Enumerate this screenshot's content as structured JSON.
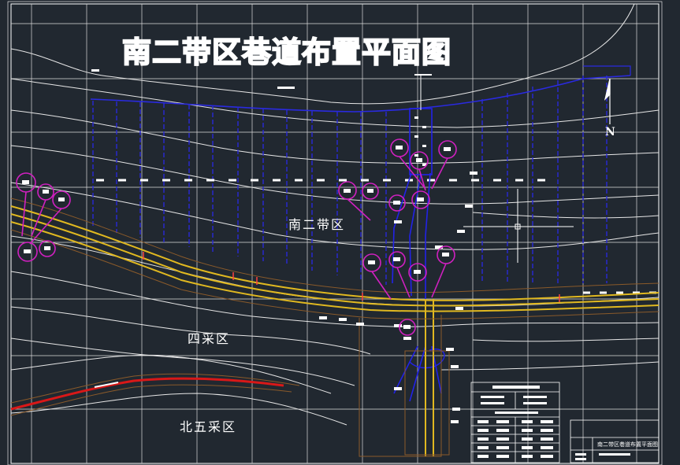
{
  "drawing": {
    "title": "南二带区巷道布置平面图",
    "north_label": "N",
    "zones": {
      "nan_er": "南二带区",
      "si_cai": "四采区",
      "bei_wu": "北五采区"
    },
    "title_block": {
      "drawing_name": "南二带区巷道布置平面图"
    }
  },
  "colors": {
    "background": "#212830",
    "grid": "#e8e8e8",
    "contour": "#e0e0e0",
    "roadway_blue": "#2222d8",
    "roadway_yellow": "#e0b820",
    "roadway_red": "#d81818",
    "boundary_brown": "#8a5a2a",
    "marker_magenta": "#d020c0"
  }
}
